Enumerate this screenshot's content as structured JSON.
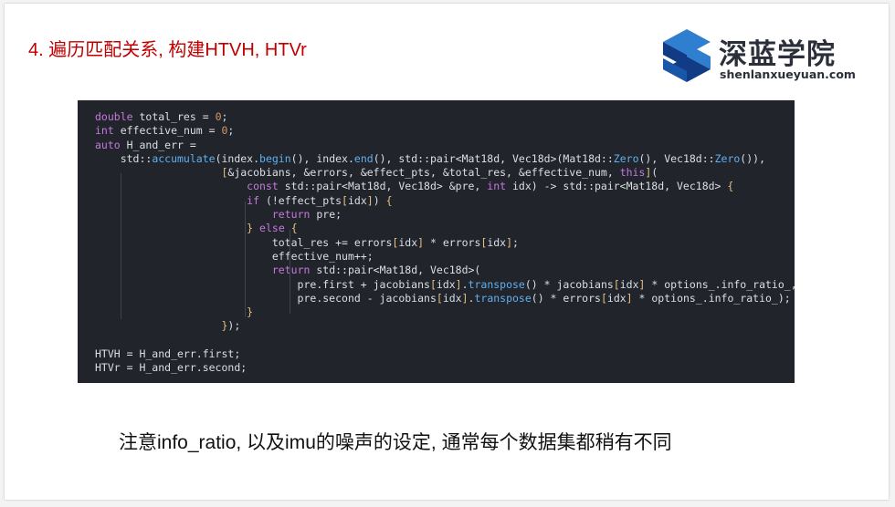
{
  "slide": {
    "title": "4. 遍历匹配关系, 构建HTVH, HTVr",
    "note": "注意info_ratio, 以及imu的噪声的设定, 通常每个数据集都稍有不同"
  },
  "logo": {
    "name_cn": "深蓝学院",
    "name_en": "shenlanxueyuan.com",
    "colors": {
      "mark_light": "#2f7fd0",
      "mark_dark": "#123b86",
      "text": "#2b2f3a"
    }
  },
  "code": {
    "background": "#21252b",
    "lines": [
      "double total_res = 0;",
      "int effective_num = 0;",
      "auto H_and_err =",
      "    std::accumulate(index.begin(), index.end(), std::pair<Mat18d, Vec18d>(Mat18d::Zero(), Vec18d::Zero()),",
      "                    [&jacobians, &errors, &effect_pts, &total_res, &effective_num, this](",
      "                        const std::pair<Mat18d, Vec18d> &pre, int idx) -> std::pair<Mat18d, Vec18d> {",
      "                        if (!effect_pts[idx]) {",
      "                            return pre;",
      "                        } else {",
      "                            total_res += errors[idx] * errors[idx];",
      "                            effective_num++;",
      "                            return std::pair<Mat18d, Vec18d>(",
      "                                pre.first + jacobians[idx].transpose() * jacobians[idx] * options_.info_ratio_,",
      "                                pre.second - jacobians[idx].transpose() * errors[idx] * options_.info_ratio_);",
      "                        }",
      "                    });",
      "",
      "HTVH = H_and_err.first;",
      "HTVr = H_and_err.second;"
    ]
  }
}
